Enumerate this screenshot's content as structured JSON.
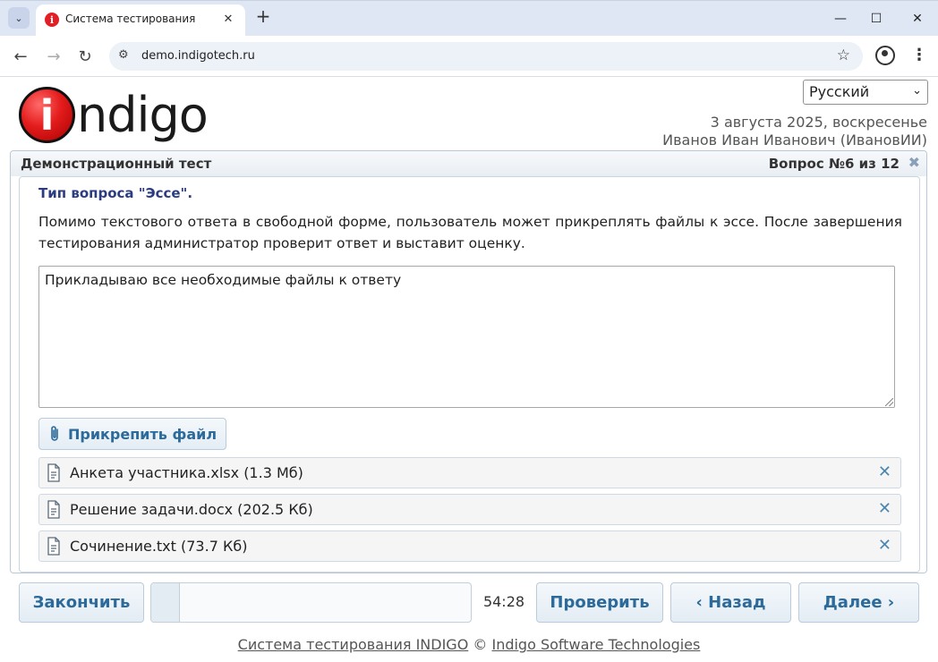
{
  "browser": {
    "tab_title": "Система тестирования",
    "favicon_letter": "i",
    "url": "demo.indigotech.ru",
    "window_controls": [
      "minimize",
      "maximize",
      "close"
    ]
  },
  "header": {
    "logo_text": "ndigo",
    "logo_i": "i",
    "language": "Русский",
    "date": "3 августа 2025, воскресенье",
    "user": "Иванов Иван Иванович (ИвановИИ)"
  },
  "test": {
    "title": "Демонстрационный тест",
    "question_counter": "Вопрос №6 из 12",
    "question_type": "Тип вопроса \"Эссе\".",
    "question_text": "Помимо текстового ответа в свободной форме, пользователь может прикреплять файлы к эссе. После завершения тестирования администратор проверит ответ и выставит оценку.",
    "answer_text": "Прикладываю все необходимые файлы к ответу",
    "attach_label": "Прикрепить файл",
    "files": [
      {
        "name": "Анкета участника.xlsx (1.3 Мб)"
      },
      {
        "name": "Решение задачи.docx (202.5 Кб)"
      },
      {
        "name": "Сочинение.txt (73.7 Кб)"
      }
    ]
  },
  "controls": {
    "finish_label": "Закончить",
    "progress_fraction": 0.09,
    "timer": "54:28",
    "check_label": "Проверить",
    "back_label": "‹ Назад",
    "next_label": "Далее ›"
  },
  "footer": {
    "link1": "Система тестирования INDIGO",
    "copyright": "©",
    "link2": "Indigo Software Technologies"
  },
  "colors": {
    "accent": "#2b6a9a",
    "question_type": "#2b3c80",
    "logo_red": "#e41c1c"
  }
}
